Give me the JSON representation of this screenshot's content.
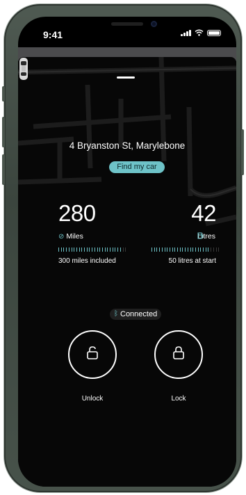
{
  "status_bar": {
    "time": "9:41"
  },
  "trip": {
    "address": "4 Bryanston St, Marylebone",
    "find_button": "Find my car"
  },
  "miles": {
    "value": "280",
    "label": "Miles",
    "included": "300 miles included",
    "fraction_remaining": 0.93
  },
  "litres": {
    "value": "42",
    "label": "Litres",
    "at_start": "50 litres at start",
    "fraction_remaining": 0.84
  },
  "connection": {
    "status": "Connected"
  },
  "controls": {
    "unlock_label": "Unlock",
    "lock_label": "Lock"
  },
  "colors": {
    "accent": "#6ec3c8",
    "background": "#000000"
  },
  "icons": {
    "miles": "gauge-icon",
    "litres": "fuel-pump-icon",
    "connection": "bluetooth-icon",
    "unlock": "unlocked-padlock-icon",
    "lock": "locked-padlock-icon"
  }
}
